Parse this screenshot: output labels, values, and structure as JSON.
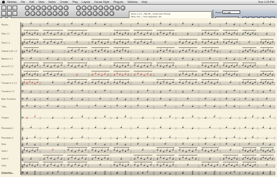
{
  "menubar": {
    "items": [
      "Sibelius",
      "File",
      "Edit",
      "View",
      "Notes",
      "Create",
      "Play",
      "Layout",
      "House Style",
      "Plug-ins",
      "Window",
      "Help"
    ],
    "right_text": "Sun 1:23 PM"
  },
  "toolbar": {
    "status_line1": "Score 1 of 1 – Bar 56 – Instrument: Piccolo",
    "status_line2": "Flute / Pic — Time Signature: 4/4"
  },
  "playback": {
    "tempo_label": "Tempo",
    "tempo_value": "q = 100",
    "time_value": "00:01:29",
    "transport": [
      "◀◀",
      "◀",
      "■",
      "▶",
      "●",
      "▶▶"
    ]
  },
  "score": {
    "instruments": [
      "Piccolo",
      "Flute 1 2",
      "Oboe 1 2",
      "Clarinet in B♭ 1 2",
      "Bassoon 1 2",
      "Horn in F 1 2",
      "Horn in F 3 4",
      "Trumpet in C 1 2",
      "Trombone 1 2",
      "Bass Trombone",
      "Tuba",
      "Timpani",
      "Percussion 1",
      "Percussion 2",
      "Harp",
      "Violin I",
      "Violin II",
      "Viola",
      "Violoncello",
      "Double Bass"
    ],
    "colors": {
      "paper": "#f7f2df",
      "staff": "#555555",
      "note": "#1a1a1a",
      "selection": "#cc2a1a"
    }
  }
}
